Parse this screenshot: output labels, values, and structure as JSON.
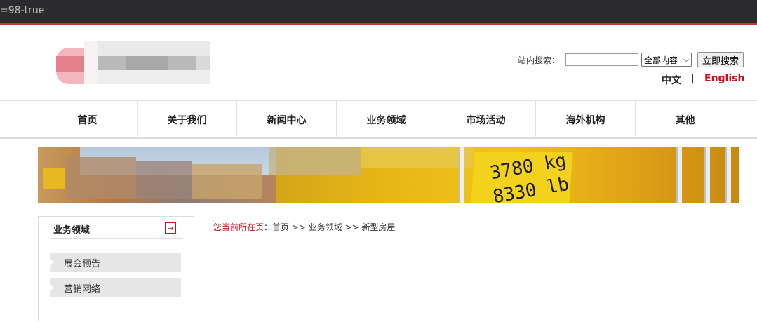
{
  "browser": {
    "url_fragment": "=98-true"
  },
  "header": {
    "search": {
      "label": "站内搜索：",
      "input_value": "",
      "scope_selected": "全部内容",
      "submit_label": "立即搜索"
    },
    "languages": {
      "zh": "中文",
      "separator": "|",
      "en": "English"
    }
  },
  "nav": {
    "items": [
      {
        "label": "首页"
      },
      {
        "label": "关于我们"
      },
      {
        "label": "新闻中心"
      },
      {
        "label": "业务领域"
      },
      {
        "label": "市场活动"
      },
      {
        "label": "海外机构"
      },
      {
        "label": "其他"
      }
    ]
  },
  "banner": {
    "text_line1": "3780 kg",
    "text_line2": "8330 lb"
  },
  "sidebar": {
    "title": "业务领域",
    "items": [
      {
        "label": "展会预告"
      },
      {
        "label": "营销网络"
      }
    ]
  },
  "breadcrumb": {
    "prefix": "您当前所在页：",
    "path": "首页 >> 业务领域 >> 新型房屋"
  },
  "colors": {
    "accent": "#c1121f",
    "topbar": "#2b2b2d"
  }
}
